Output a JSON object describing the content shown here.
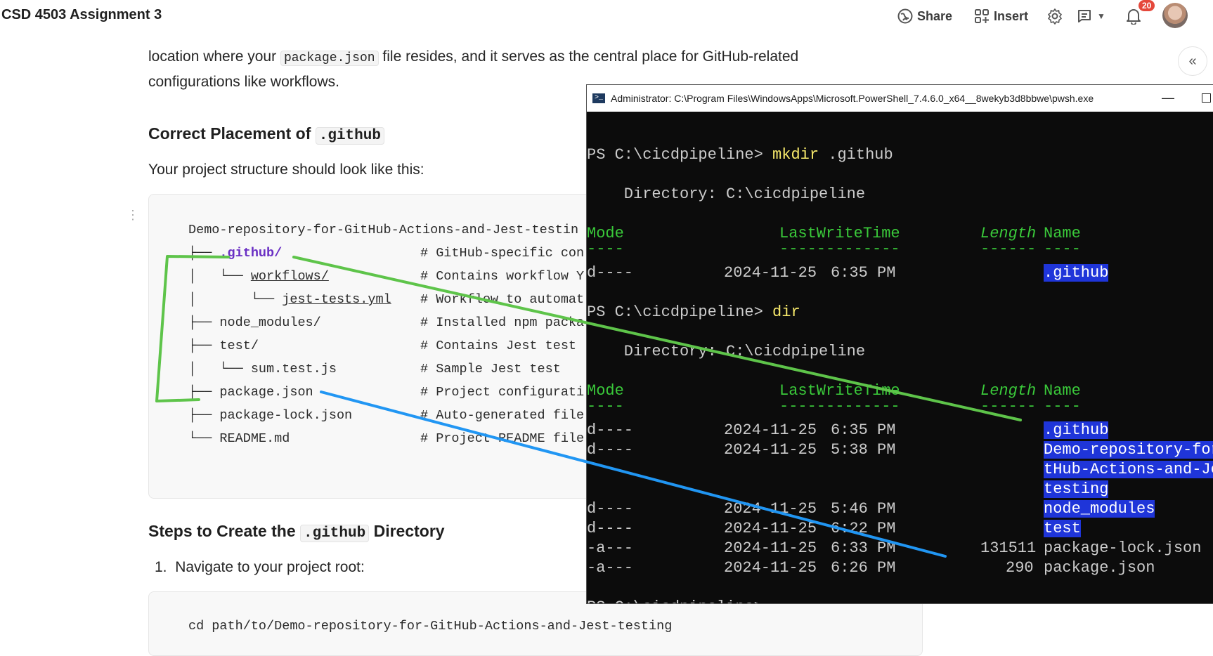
{
  "topbar": {
    "title": "CSD 4503 Assignment 3",
    "share_label": "Share",
    "insert_label": "Insert",
    "notifications_count": "20"
  },
  "doc": {
    "intro_line1_before": "location where your",
    "intro_code": "package.json",
    "intro_line1_after": "file resides, and it serves as the central place for GitHub-related",
    "intro_line2": "configurations like workflows.",
    "heading1_text": "Correct Placement of",
    "heading1_code": ".github",
    "para1": "Your project structure should look like this:",
    "tree": [
      {
        "prefix": "Demo-repository-for-GitHub-Actions-and-Jest-testin",
        "name": "",
        "comment": ""
      },
      {
        "prefix": "├── ",
        "name": ".github/",
        "comment": "# GitHub-specific con"
      },
      {
        "prefix": "│   └── ",
        "name": "workflows/",
        "comment": "# Contains workflow Y"
      },
      {
        "prefix": "│       └── ",
        "name": "jest-tests.yml",
        "comment": "# Workflow to automat"
      },
      {
        "prefix": "├── ",
        "name": "node_modules/",
        "comment": "# Installed npm packa"
      },
      {
        "prefix": "├── ",
        "name": "test/",
        "comment": "# Contains Jest test"
      },
      {
        "prefix": "│   └── ",
        "name": "sum.test.js",
        "comment": "# Sample Jest test"
      },
      {
        "prefix": "├── ",
        "name": "package.json",
        "comment": "# Project configurati"
      },
      {
        "prefix": "├── ",
        "name": "package-lock.json",
        "comment": "# Auto-generated file"
      },
      {
        "prefix": "└── ",
        "name": "README.md",
        "comment": "# Project README file"
      }
    ],
    "heading2_before": "Steps to Create the",
    "heading2_code": ".github",
    "heading2_after": "Directory",
    "step1_num": "1.",
    "step1_text": "Navigate to your project root:",
    "cmd": "cd path/to/Demo-repository-for-GitHub-Actions-and-Jest-testing"
  },
  "terminal": {
    "title": "Administrator: C:\\Program Files\\WindowsApps\\Microsoft.PowerShell_7.4.6.0_x64__8wekyb3d8bbwe\\pwsh.exe",
    "prompt": "PS C:\\cicdpipeline> ",
    "cmd1": "mkdir",
    "cmd1_arg": ".github",
    "dir_line": "    Directory: C:\\cicdpipeline",
    "col_mode": "Mode",
    "col_lwt": "LastWriteTime",
    "col_length": "Length",
    "col_name": "Name",
    "sep_mode": "----",
    "sep_lwt": "-------------",
    "sep_length": "------",
    "sep_name": "----",
    "row_mkdir": {
      "mode": "d----",
      "date": "2024-11-25",
      "time": "6:35 PM",
      "length": "",
      "name": ".github"
    },
    "cmd2": "dir",
    "rows": [
      {
        "mode": "d----",
        "date": "2024-11-25",
        "time": "6:35 PM",
        "length": "",
        "name": ".github"
      },
      {
        "mode": "d----",
        "date": "2024-11-25",
        "time": "5:38 PM",
        "length": "",
        "name": "Demo-repository-for"
      },
      {
        "mode": "",
        "date": "",
        "time": "",
        "length": "",
        "name": "tHub-Actions-and-Je"
      },
      {
        "mode": "",
        "date": "",
        "time": "",
        "length": "",
        "name": "testing"
      },
      {
        "mode": "d----",
        "date": "2024-11-25",
        "time": "5:46 PM",
        "length": "",
        "name": "node_modules"
      },
      {
        "mode": "d----",
        "date": "2024-11-25",
        "time": "6:22 PM",
        "length": "",
        "name": "test"
      },
      {
        "mode": "-a---",
        "date": "2024-11-25",
        "time": "6:33 PM",
        "length": "131511",
        "name": "package-lock.json"
      },
      {
        "mode": "-a---",
        "date": "2024-11-25",
        "time": "6:26 PM",
        "length": "290",
        "name": "package.json"
      }
    ]
  },
  "annotation_colors": {
    "green": "#5ec44a",
    "blue": "#2196f3"
  }
}
